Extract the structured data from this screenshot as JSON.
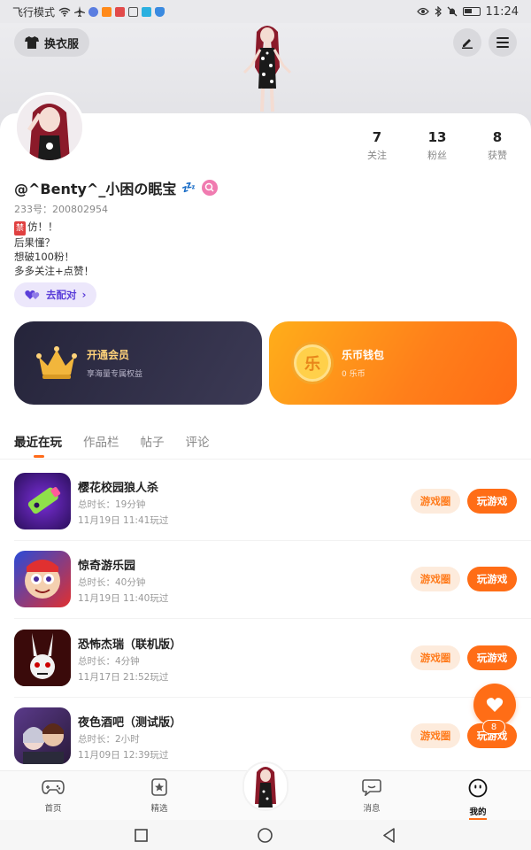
{
  "status_bar": {
    "left_text": "飞行模式",
    "time": "11:24"
  },
  "header": {
    "outfit_button": "换衣服"
  },
  "profile": {
    "stats": [
      {
        "value": "7",
        "label": "关注"
      },
      {
        "value": "13",
        "label": "粉丝"
      },
      {
        "value": "8",
        "label": "获赞"
      }
    ],
    "username": "@^Benty^_小困の眠宝",
    "username_emoji": "💤",
    "uid": "233号：200802954",
    "bio_ban_badge": "禁",
    "bio_lines": [
      "仿！！",
      "后果懂？",
      "想破100粉！",
      "多多关注+点赞！"
    ],
    "match_button": "去配对"
  },
  "vip_card": {
    "title": "开通会员",
    "subtitle": "享海量专属权益"
  },
  "wallet_card": {
    "title": "乐币钱包",
    "subtitle": "0 乐币",
    "coin_glyph": "乐"
  },
  "tabs": [
    {
      "label": "最近在玩",
      "active": true
    },
    {
      "label": "作品栏",
      "active": false
    },
    {
      "label": "帖子",
      "active": false
    },
    {
      "label": "评论",
      "active": false
    }
  ],
  "games": [
    {
      "title": "樱花校园狼人杀",
      "duration": "总时长：19分钟",
      "last_played": "11月19日 11:41玩过",
      "circle_button": "游戏圈",
      "play_button": "玩游戏"
    },
    {
      "title": "惊奇游乐园",
      "duration": "总时长：40分钟",
      "last_played": "11月19日 11:40玩过",
      "circle_button": "游戏圈",
      "play_button": "玩游戏"
    },
    {
      "title": "恐怖杰瑞（联机版）",
      "duration": "总时长：4分钟",
      "last_played": "11月17日 21:52玩过",
      "circle_button": "游戏圈",
      "play_button": "玩游戏"
    },
    {
      "title": "夜色酒吧（测试版）",
      "duration": "总时长：2小时",
      "last_played": "11月09日 12:39玩过",
      "circle_button": "游戏圈",
      "play_button": "玩游戏"
    }
  ],
  "fab": {
    "badge_count": "8"
  },
  "bottom_nav": [
    {
      "label": "首页",
      "icon": "gamepad-icon"
    },
    {
      "label": "精选",
      "icon": "star-bookmark-icon"
    },
    {
      "label": "消息",
      "icon": "chat-icon"
    },
    {
      "label": "我的",
      "icon": "face-icon",
      "active": true
    }
  ],
  "colors": {
    "accent": "#ff6d16",
    "vip_bg": "#2c2b42",
    "match_purple": "#5b3fd9"
  }
}
